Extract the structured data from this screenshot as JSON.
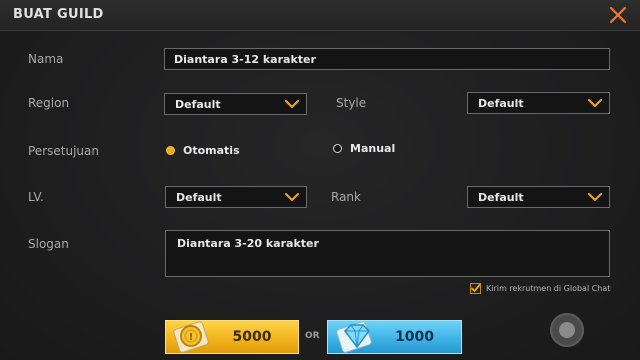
{
  "header": {
    "title": "BUAT GUILD"
  },
  "form": {
    "name_label": "Nama",
    "name_value": "Diantara 3-12 karakter",
    "region_label": "Region",
    "region_value": "Default",
    "style_label": "Style",
    "style_value": "Default",
    "approval_label": "Persetujuan",
    "approval_options": [
      {
        "label": "Otomatis",
        "selected": true
      },
      {
        "label": "Manual",
        "selected": false
      }
    ],
    "level_label": "LV.",
    "level_value": "Default",
    "rank_label": "Rank",
    "rank_value": "Default",
    "slogan_label": "Slogan",
    "slogan_value": "Diantara 3-20 karakter",
    "global_chat_label": "Kirim rekrutmen di Global Chat",
    "global_chat_checked": true
  },
  "costs": {
    "gold_amount": "5000",
    "or_label": "OR",
    "diamond_amount": "1000"
  },
  "icons": {
    "close": "close-icon",
    "chevron": "chevron-down-icon",
    "coin": "gold-coin-icon",
    "diamond": "diamond-icon",
    "check": "checkmark-icon"
  },
  "colors": {
    "accent_orange": "#f0ab1d",
    "gold_button": "#f2b51c",
    "diamond_button": "#3fb3e6",
    "background": "#1e1e1f"
  }
}
